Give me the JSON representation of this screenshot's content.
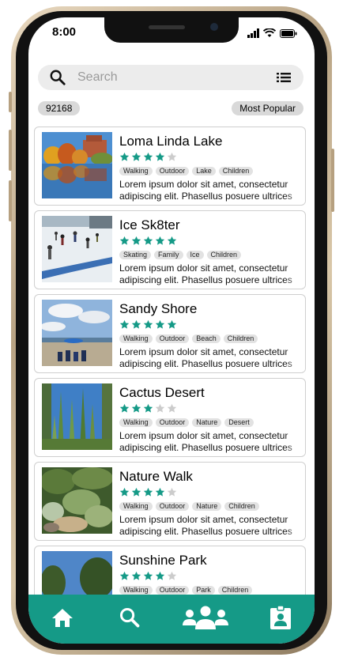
{
  "status": {
    "time": "8:00"
  },
  "search": {
    "placeholder": "Search"
  },
  "filters": {
    "zip": "92168",
    "sort": "Most Popular"
  },
  "colors": {
    "accent": "#159a87",
    "star_filled": "#159a87",
    "star_empty": "#cccccc"
  },
  "places": [
    {
      "title": "Loma Linda Lake",
      "rating": 4,
      "tags": [
        "Walking",
        "Outdoor",
        "Lake",
        "Children"
      ],
      "desc1": "Lorem ipsum dolor sit amet, consectetur",
      "desc2": "adipiscing elit. Phasellus posuere ultrices"
    },
    {
      "title": "Ice Sk8ter",
      "rating": 5,
      "tags": [
        "Skating",
        "Family",
        "Ice",
        "Children"
      ],
      "desc1": "Lorem ipsum dolor sit amet, consectetur",
      "desc2": "adipiscing elit. Phasellus posuere ultrices"
    },
    {
      "title": "Sandy Shore",
      "rating": 5,
      "tags": [
        "Walking",
        "Outdoor",
        "Beach",
        "Children"
      ],
      "desc1": "Lorem ipsum dolor sit amet, consectetur",
      "desc2": "adipiscing elit. Phasellus posuere ultrices"
    },
    {
      "title": "Cactus Desert",
      "rating": 3,
      "tags": [
        "Walking",
        "Outdoor",
        "Nature",
        "Desert"
      ],
      "desc1": "Lorem ipsum dolor sit amet, consectetur",
      "desc2": "adipiscing elit. Phasellus posuere ultrices"
    },
    {
      "title": "Nature Walk",
      "rating": 4,
      "tags": [
        "Walking",
        "Outdoor",
        "Nature",
        "Children"
      ],
      "desc1": "Lorem ipsum dolor sit amet, consectetur",
      "desc2": "adipiscing elit. Phasellus posuere ultrices"
    },
    {
      "title": "Sunshine Park",
      "rating": 4,
      "tags": [
        "Walking",
        "Outdoor",
        "Park",
        "Children"
      ],
      "desc1": "",
      "desc2": ""
    }
  ],
  "nav": [
    {
      "icon": "home-icon"
    },
    {
      "icon": "search-icon"
    },
    {
      "icon": "people-icon"
    },
    {
      "icon": "badge-icon"
    }
  ]
}
